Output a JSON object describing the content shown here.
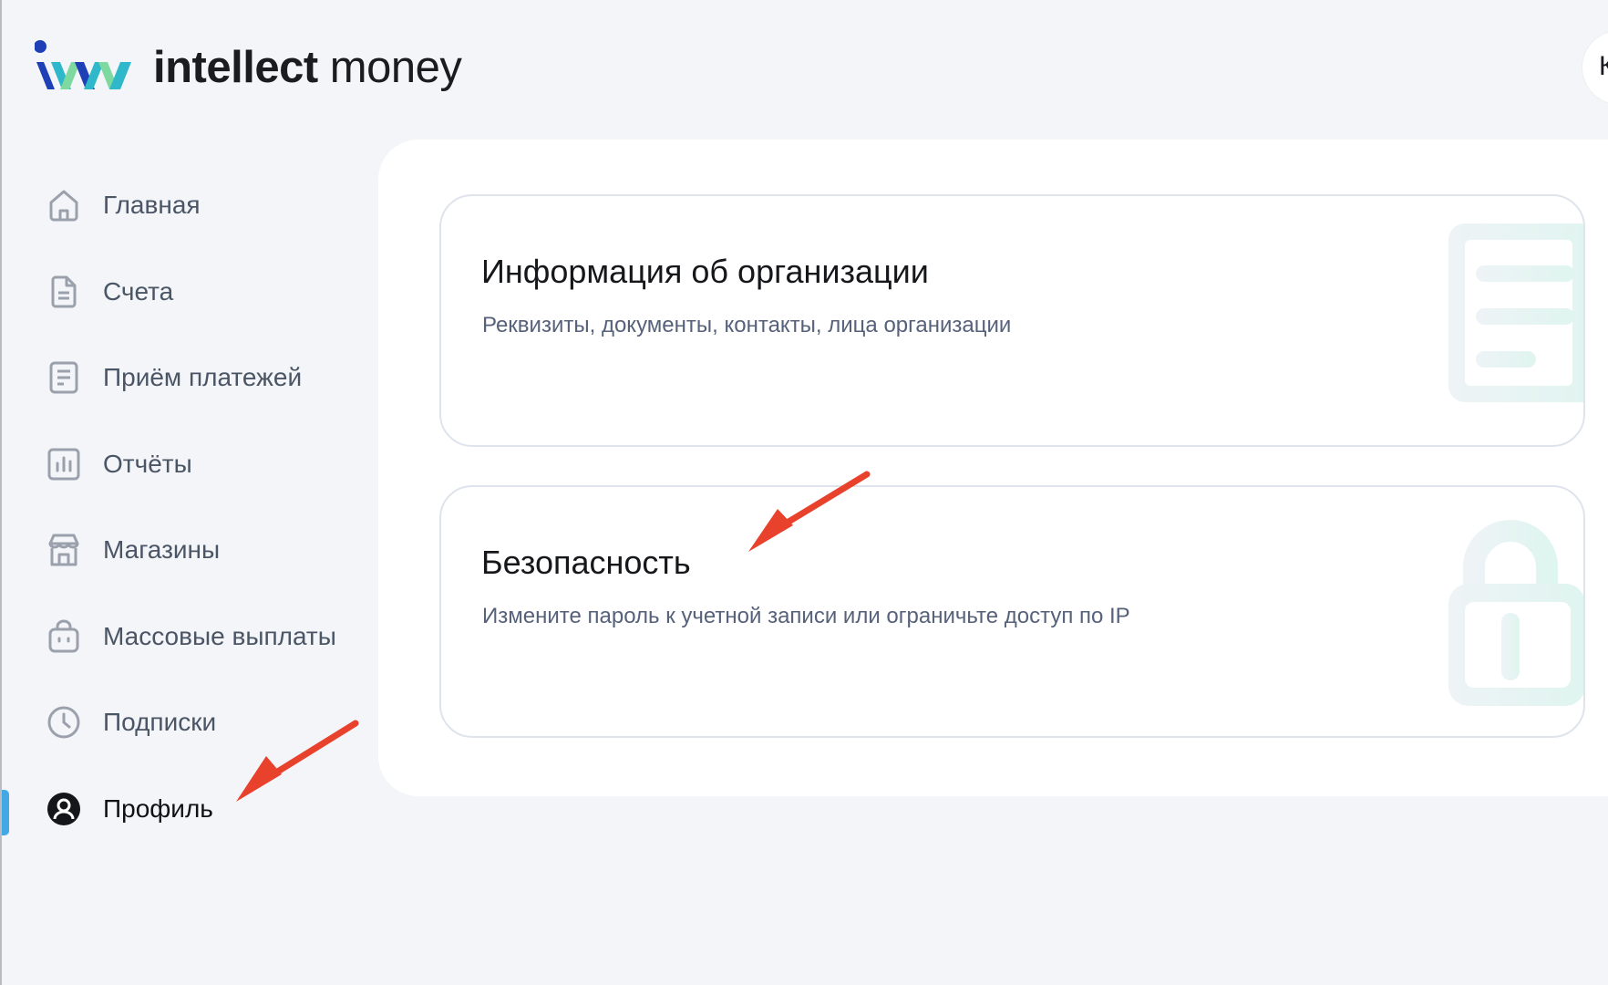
{
  "brand": {
    "name_bold": "intellect",
    "name_light": "money",
    "colors": {
      "blue": "#1e3fb5",
      "teal": "#2fb8c9",
      "green": "#7ed9a1"
    }
  },
  "header": {
    "avatar_letter": "К"
  },
  "sidebar": {
    "items": [
      {
        "label": "Главная",
        "icon": "home-icon",
        "active": false
      },
      {
        "label": "Счета",
        "icon": "document-icon",
        "active": false
      },
      {
        "label": "Приём платежей",
        "icon": "receipt-icon",
        "active": false
      },
      {
        "label": "Отчёты",
        "icon": "chart-icon",
        "active": false
      },
      {
        "label": "Магазины",
        "icon": "store-icon",
        "active": false
      },
      {
        "label": "Массовые выплаты",
        "icon": "bag-icon",
        "active": false
      },
      {
        "label": "Подписки",
        "icon": "clock-icon",
        "active": false
      },
      {
        "label": "Профиль",
        "icon": "user-icon",
        "active": true
      }
    ]
  },
  "cards": [
    {
      "title": "Информация об организации",
      "description": "Реквизиты, документы, контакты, лица организации",
      "illustration": "document-icon"
    },
    {
      "title": "Безопасность",
      "description": "Измените пароль к учетной записи или ограничьте доступ по IP",
      "illustration": "lock-icon"
    }
  ],
  "colors": {
    "background": "#f4f5f8",
    "panel": "#ffffff",
    "active_indicator": "#42a8e6",
    "annotation_arrow": "#e8412c",
    "text_muted": "#4a5566"
  }
}
